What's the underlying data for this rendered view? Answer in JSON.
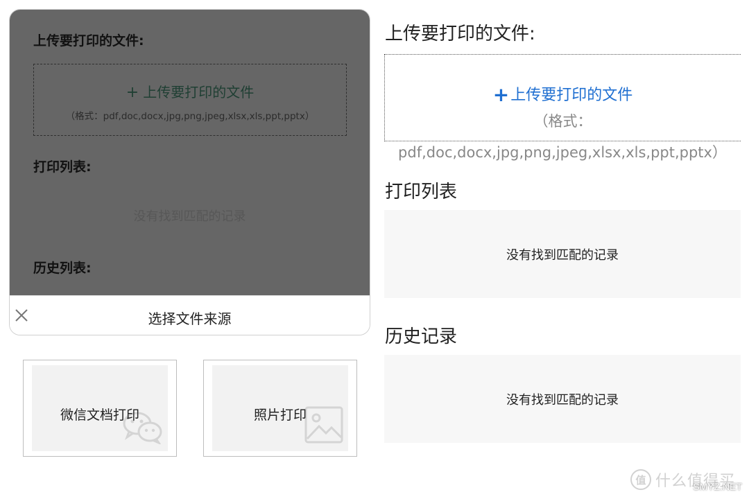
{
  "left_panel": {
    "upload_title": "上传要打印的文件:",
    "upload_button": "上传要打印的文件",
    "upload_plus": "+",
    "upload_formats": "（格式：pdf,doc,docx,jpg,png,jpeg,xlsx,xls,ppt,pptx）",
    "print_list_title": "打印列表:",
    "empty_text": "没有找到匹配的记录",
    "history_title": "历史列表:",
    "sheet_title": "选择文件来源",
    "close_glyph": "×"
  },
  "source_options": [
    {
      "label": "微信文档打印",
      "icon": "wechat-icon"
    },
    {
      "label": "照片打印",
      "icon": "image-icon"
    }
  ],
  "right_panel": {
    "upload_title": "上传要打印的文件:",
    "upload_plus": "+",
    "upload_button": "上传要打印的文件",
    "upload_formats_line1": "（格式：",
    "upload_formats_line2": "pdf,doc,docx,jpg,png,jpeg,xlsx,xls,ppt,pptx）",
    "print_list_title": "打印列表",
    "print_list_empty": "没有找到匹配的记录",
    "history_title": "历史记录",
    "history_empty": "没有找到匹配的记录"
  },
  "watermark": {
    "badge": "值",
    "text": "什么值得买",
    "sub": "SMYZ.NET"
  },
  "colors": {
    "accent_blue": "#1f6fd1",
    "overlay": "#666666",
    "card_bg": "#f2f2f2",
    "empty_bg": "#f7f7f7"
  }
}
